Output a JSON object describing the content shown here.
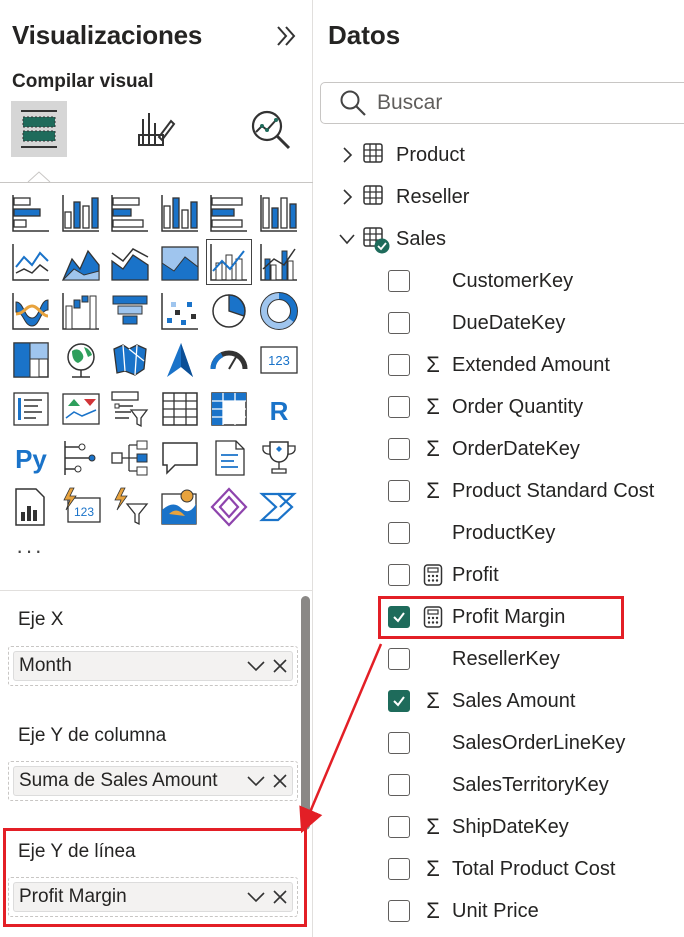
{
  "visualizations": {
    "title": "Visualizaciones",
    "compile_label": "Compilar visual",
    "tools": [
      {
        "icon": "build-visual-icon",
        "active": true
      },
      {
        "icon": "format-visual-icon",
        "active": false
      },
      {
        "icon": "analytics-icon",
        "active": false
      }
    ],
    "more": "···",
    "gallery_rows": [
      [
        "stacked-bar-chart-icon",
        "stacked-column-chart-icon",
        "clustered-bar-chart-icon",
        "clustered-column-chart-icon",
        "100-stacked-bar-chart-icon",
        "100-stacked-column-chart-icon"
      ],
      [
        "line-chart-icon",
        "area-chart-icon",
        "stacked-area-chart-icon",
        "100-stacked-area-chart-icon",
        "line-and-stacked-column-chart-icon",
        "line-and-clustered-column-chart-icon"
      ],
      [
        "ribbon-chart-icon",
        "waterfall-chart-icon",
        "funnel-chart-icon",
        "scatter-chart-icon",
        "pie-chart-icon",
        "donut-chart-icon"
      ],
      [
        "treemap-icon",
        "map-icon",
        "filled-map-icon",
        "azure-map-icon",
        "gauge-icon",
        "card-icon"
      ],
      [
        "multi-row-card-icon",
        "kpi-icon",
        "slicer-icon",
        "table-icon",
        "matrix-icon",
        "r-script-visual-icon"
      ],
      [
        "python-visual-icon",
        "key-influencers-icon",
        "decomposition-tree-icon",
        "qa-icon",
        "smart-narrative-icon",
        "metrics-icon"
      ],
      [
        "paginated-report-icon",
        "power-apps-card-icon",
        "power-apps-slicer-icon",
        "arcgis-map-icon",
        "power-apps-icon",
        "power-automate-icon"
      ]
    ],
    "r_label": "R",
    "py_label": "Py",
    "card_label": "123"
  },
  "wells": {
    "x_axis": {
      "label": "Eje X",
      "field": "Month"
    },
    "column_y": {
      "label": "Eje Y de columna",
      "field": "Suma de Sales Amount"
    },
    "line_y": {
      "label": "Eje Y de línea",
      "field": "Profit Margin"
    }
  },
  "data_pane": {
    "title": "Datos",
    "search_placeholder": "Buscar",
    "tables": [
      {
        "name": "Product",
        "expanded": false
      },
      {
        "name": "Reseller",
        "expanded": false
      },
      {
        "name": "Sales",
        "expanded": true
      }
    ],
    "fields": [
      {
        "name": "CustomerKey",
        "icon": "none",
        "checked": false
      },
      {
        "name": "DueDateKey",
        "icon": "none",
        "checked": false
      },
      {
        "name": "Extended Amount",
        "icon": "sigma",
        "checked": false
      },
      {
        "name": "Order Quantity",
        "icon": "sigma",
        "checked": false
      },
      {
        "name": "OrderDateKey",
        "icon": "sigma",
        "checked": false
      },
      {
        "name": "Product Standard Cost",
        "icon": "sigma",
        "checked": false
      },
      {
        "name": "ProductKey",
        "icon": "none",
        "checked": false
      },
      {
        "name": "Profit",
        "icon": "calculator",
        "checked": false
      },
      {
        "name": "Profit Margin",
        "icon": "calculator",
        "checked": true
      },
      {
        "name": "ResellerKey",
        "icon": "none",
        "checked": false
      },
      {
        "name": "Sales Amount",
        "icon": "sigma",
        "checked": true
      },
      {
        "name": "SalesOrderLineKey",
        "icon": "none",
        "checked": false
      },
      {
        "name": "SalesTerritoryKey",
        "icon": "none",
        "checked": false
      },
      {
        "name": "ShipDateKey",
        "icon": "sigma",
        "checked": false
      },
      {
        "name": "Total Product Cost",
        "icon": "sigma",
        "checked": false
      },
      {
        "name": "Unit Price",
        "icon": "sigma",
        "checked": false
      }
    ],
    "sigma_symbol": "Σ"
  },
  "colors": {
    "accent_highlight": "#e31f26",
    "checkbox_checked": "#1e6b5b",
    "chart_blue": "#1a73c9",
    "chart_teal": "#118dff"
  }
}
